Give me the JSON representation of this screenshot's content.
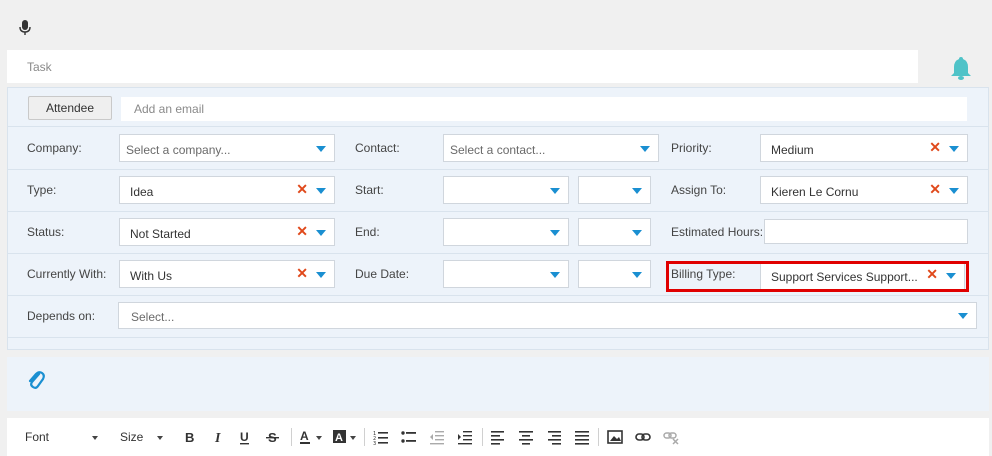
{
  "task": {
    "placeholder": "Task"
  },
  "attendee": {
    "button_label": "Attendee",
    "email_placeholder": "Add an email"
  },
  "fields": {
    "company": {
      "label": "Company:",
      "placeholder": "Select a company..."
    },
    "contact": {
      "label": "Contact:",
      "placeholder": "Select a contact..."
    },
    "priority": {
      "label": "Priority:",
      "value": "Medium"
    },
    "type": {
      "label": "Type:",
      "value": "Idea"
    },
    "start": {
      "label": "Start:"
    },
    "assign_to": {
      "label": "Assign To:",
      "value": "Kieren Le Cornu"
    },
    "status": {
      "label": "Status:",
      "value": "Not Started"
    },
    "end": {
      "label": "End:"
    },
    "estimated_hours": {
      "label": "Estimated Hours:",
      "value": ""
    },
    "currently_with": {
      "label": "Currently With:",
      "value": "With Us"
    },
    "due_date": {
      "label": "Due Date:"
    },
    "billing_type": {
      "label": "Billing Type:",
      "value": "Support Services Support..."
    },
    "depends_on": {
      "label": "Depends on:",
      "placeholder": "Select..."
    }
  },
  "toolbar": {
    "font_label": "Font",
    "size_label": "Size"
  },
  "colors": {
    "accent": "#1a8fd1",
    "clear": "#e0491b",
    "highlight": "#e00000",
    "bell": "#4fc3c8"
  }
}
